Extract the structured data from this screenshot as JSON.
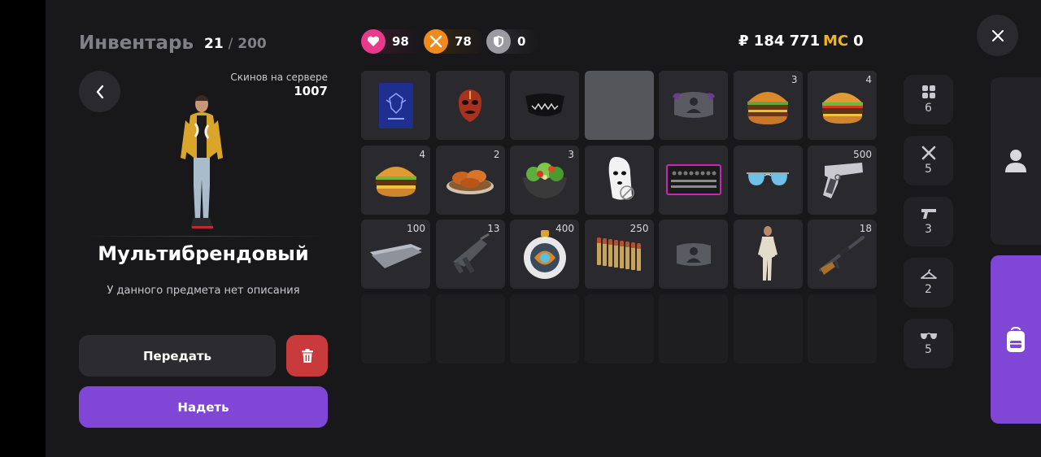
{
  "header": {
    "title": "Инвентарь",
    "slots_used": "21",
    "slots_sep": "/",
    "slots_max": "200"
  },
  "skins": {
    "label": "Скинов на сервере",
    "value": "1007"
  },
  "selected_item": {
    "name": "Мультибрендовый",
    "description": "У данного предмета нет описания"
  },
  "actions": {
    "transfer_label": "Передать",
    "equip_label": "Надеть"
  },
  "stats": {
    "health": "98",
    "food": "78",
    "armor": "0"
  },
  "currency": {
    "money": "₽ 184 771",
    "mc_label": "MC",
    "mc_value": "0"
  },
  "colors": {
    "accent": "#8046d6",
    "danger": "#c93a3d",
    "health": "#e73a8a",
    "food": "#f08a1c",
    "mc": "#f2b418"
  },
  "inventory": [
    {
      "icon": "passport-icon",
      "qty": ""
    },
    {
      "icon": "red-mask-icon",
      "qty": ""
    },
    {
      "icon": "black-mask-icon",
      "qty": ""
    },
    {
      "icon": "empty-selected",
      "qty": ""
    },
    {
      "icon": "cap-icon",
      "qty": ""
    },
    {
      "icon": "burger-icon",
      "qty": "3"
    },
    {
      "icon": "burger-icon",
      "qty": "4"
    },
    {
      "icon": "burger-icon",
      "qty": "4"
    },
    {
      "icon": "chicken-wings-icon",
      "qty": "2"
    },
    {
      "icon": "salad-icon",
      "qty": "3"
    },
    {
      "icon": "balaclava-icon",
      "qty": ""
    },
    {
      "icon": "toolkit-icon",
      "qty": ""
    },
    {
      "icon": "sunglasses-icon",
      "qty": ""
    },
    {
      "icon": "pistol-icon",
      "qty": "500"
    },
    {
      "icon": "metal-sheet-icon",
      "qty": "100"
    },
    {
      "icon": "smg-icon",
      "qty": "13"
    },
    {
      "icon": "decor-ball-icon",
      "qty": "400"
    },
    {
      "icon": "ammo-icon",
      "qty": "250"
    },
    {
      "icon": "accessory-icon",
      "qty": ""
    },
    {
      "icon": "skin-icon",
      "qty": ""
    },
    {
      "icon": "rifle-icon",
      "qty": "18"
    }
  ],
  "categories": [
    {
      "icon": "grid-icon",
      "count": "6"
    },
    {
      "icon": "weapons-icon",
      "count": "5"
    },
    {
      "icon": "gun-icon",
      "count": "3"
    },
    {
      "icon": "hanger-icon",
      "count": "2"
    },
    {
      "icon": "glasses-icon",
      "count": "5"
    }
  ]
}
